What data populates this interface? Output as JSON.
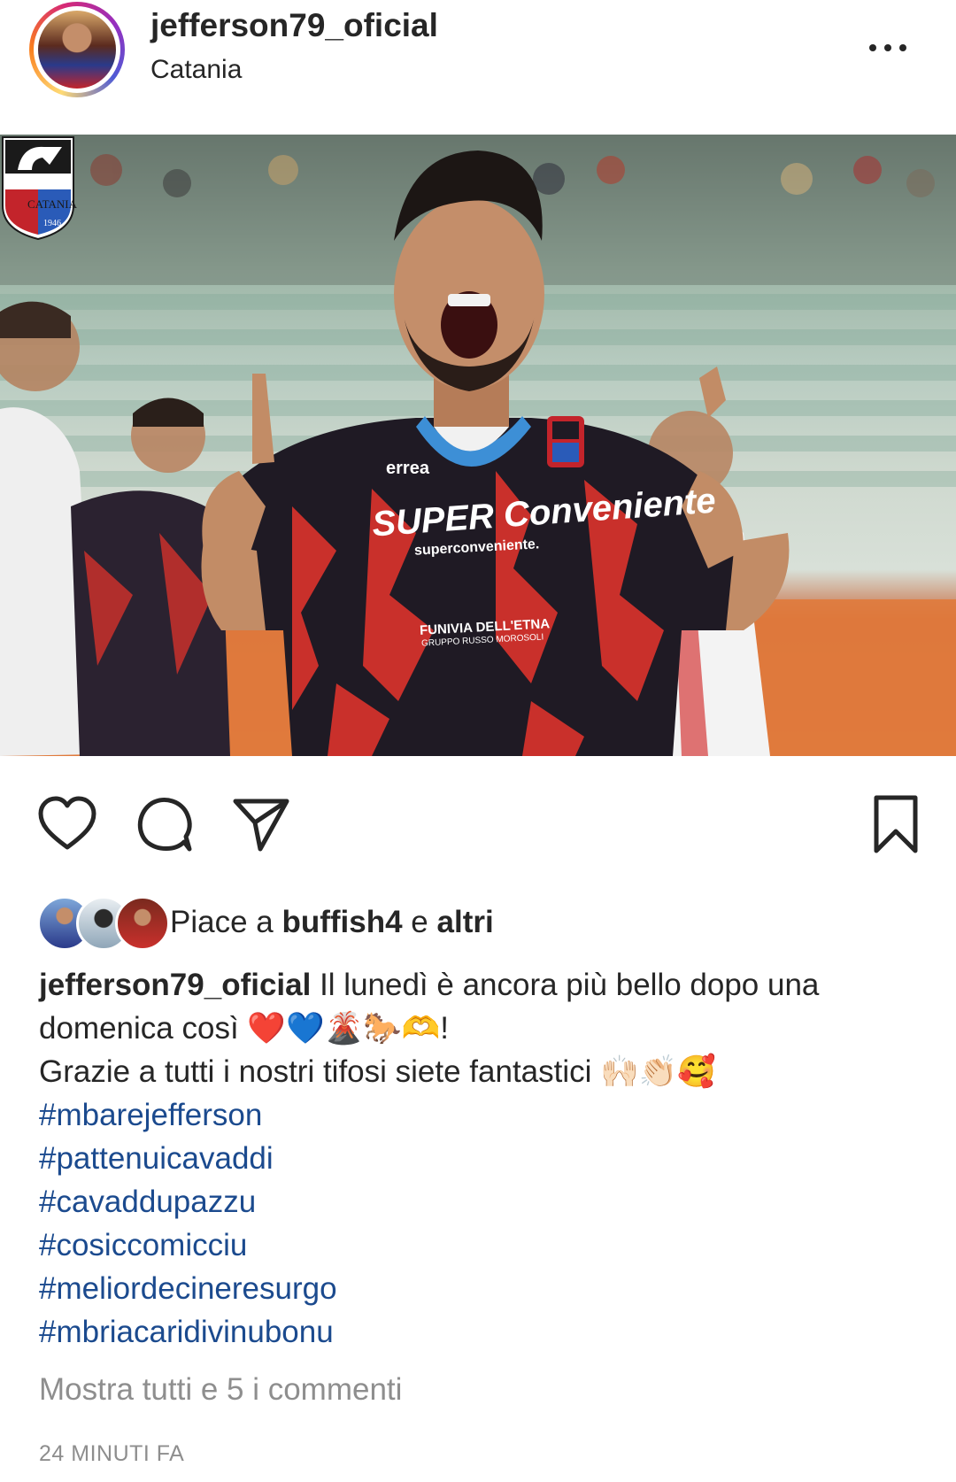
{
  "post": {
    "username": "jefferson79_oficial",
    "location": "Catania",
    "photo_alt": "Catania player celebrating",
    "jersey_sponsor": "SUPER Conveniente",
    "jersey_sponsor_sub": "superconveniente.",
    "jersey_sponsor2": "FUNIVIA DELL'ETNA",
    "jersey_sponsor2_sub": "GRUPPO RUSSO MOROSOLI",
    "jersey_brand": "errea",
    "club_logo_text": "CATANIA",
    "club_logo_year": "1946"
  },
  "likes": {
    "prefix": "Piace a ",
    "user": "buffish4",
    "middle": " e ",
    "others": "altri"
  },
  "caption": {
    "username": "jefferson79_oficial",
    "line1": " Il lunedì è ancora più bello dopo una domenica così ❤️💙🌋🐎🫶!",
    "line2": "Grazie a tutti i nostri tifosi siete fantastici 🙌🏻👏🏻🥰",
    "hashtags": [
      "#mbarejefferson",
      "#pattenuicavaddi",
      "#cavaddupazzu",
      "#cosiccomicciu",
      "#meliordecineresurgo",
      "#mbriacaridivinubonu"
    ]
  },
  "comments_link": "Mostra tutti e 5 i commenti",
  "timestamp": "24 MINUTI FA",
  "icons": {
    "more": "more-icon",
    "like": "heart-icon",
    "comment": "comment-icon",
    "share": "send-icon",
    "save": "bookmark-icon"
  },
  "colors": {
    "text": "#262626",
    "muted": "#8e8e8e",
    "hashtag": "#1b4a8e",
    "catania_red": "#c3242b",
    "catania_blue": "#2a5bb8"
  }
}
